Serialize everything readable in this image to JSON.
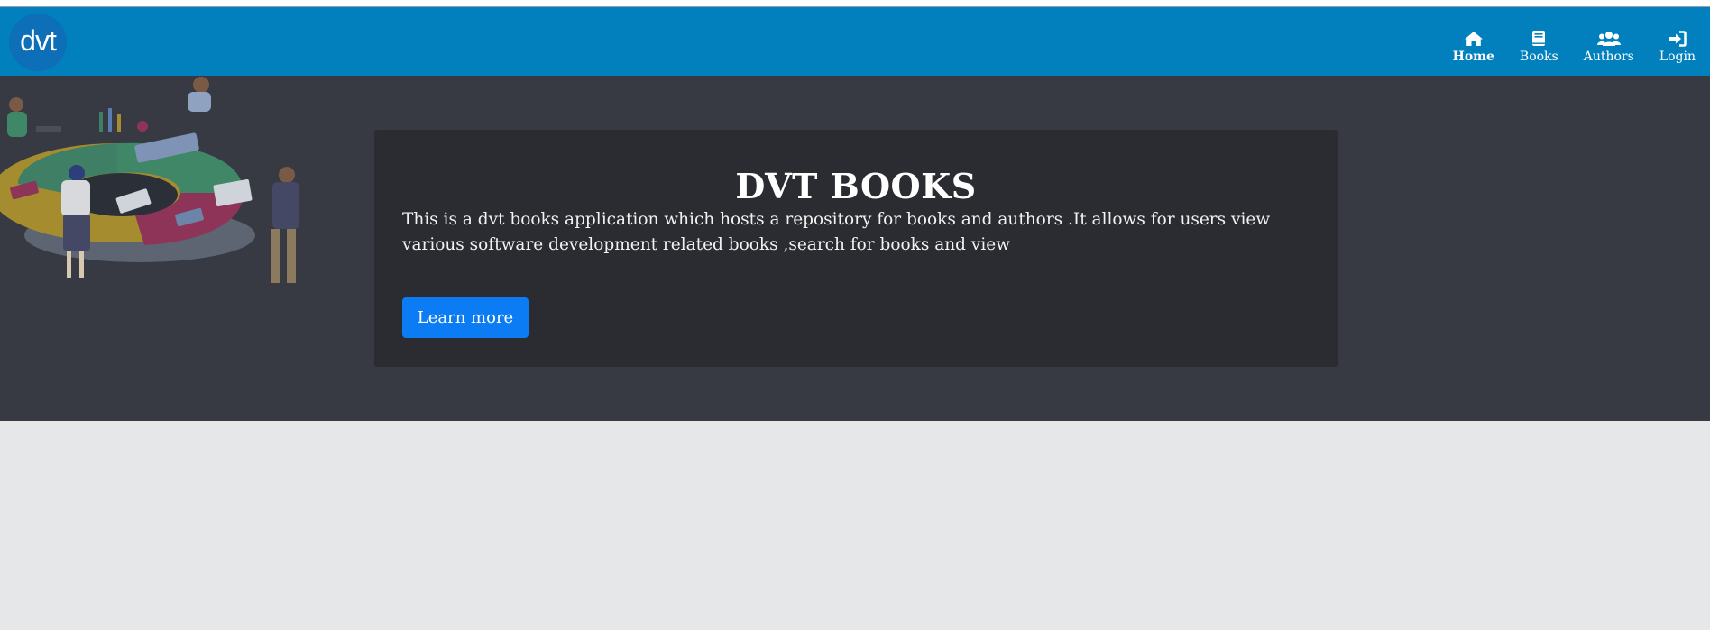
{
  "header": {
    "logo_text": "dvt",
    "nav": [
      {
        "label": "Home",
        "icon": "home-icon"
      },
      {
        "label": "Books",
        "icon": "book-icon"
      },
      {
        "label": "Authors",
        "icon": "users-icon"
      },
      {
        "label": "Login",
        "icon": "login-icon"
      }
    ]
  },
  "hero": {
    "title": "DVT BOOKS",
    "description": "This is a dvt books application which hosts a repository for books and authors .It allows for users view various software development related books ,search for books and view",
    "button_label": "Learn more"
  },
  "colors": {
    "navbar": "#0180bd",
    "hero_bg": "#373a43",
    "card_bg": "#2a2c31",
    "button": "#0b7cf3",
    "page_bg": "#e6e7e9"
  }
}
